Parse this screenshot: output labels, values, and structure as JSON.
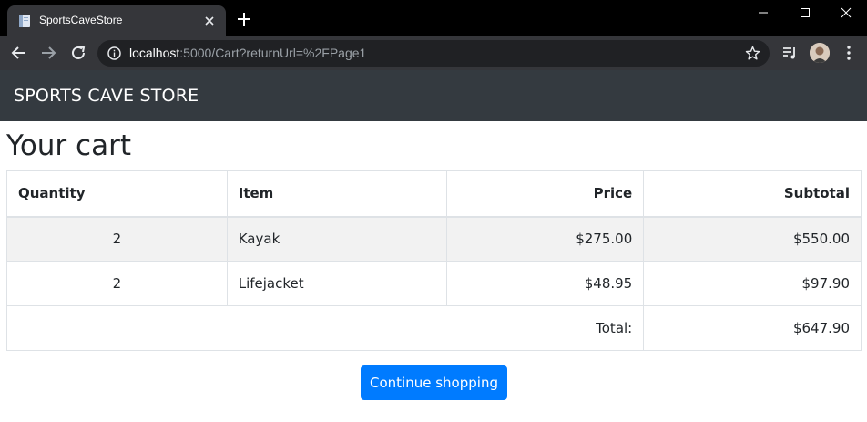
{
  "browser": {
    "tab_title": "SportsCaveStore",
    "url_host": "localhost",
    "url_rest": ":5000/Cart?returnUrl=%2FPage1"
  },
  "icons": {
    "favicon": "document-icon",
    "tab_close": "close-icon",
    "new_tab": "plus-icon",
    "back": "back-arrow-icon",
    "forward": "forward-arrow-icon",
    "reload": "reload-icon",
    "info": "info-icon",
    "bookmark": "star-icon",
    "media": "media-playlist-icon",
    "profile": "avatar",
    "menu": "kebab-menu-icon"
  },
  "navbar": {
    "brand": "SPORTS CAVE STORE"
  },
  "page": {
    "title": "Your cart"
  },
  "cart": {
    "headers": {
      "quantity": "Quantity",
      "item": "Item",
      "price": "Price",
      "subtotal": "Subtotal"
    },
    "rows": [
      {
        "quantity": "2",
        "item": "Kayak",
        "price": "$275.00",
        "subtotal": "$550.00"
      },
      {
        "quantity": "2",
        "item": "Lifejacket",
        "price": "$48.95",
        "subtotal": "$97.90"
      }
    ],
    "total_label": "Total:",
    "total_value": "$647.90"
  },
  "actions": {
    "continue_shopping": "Continue shopping"
  },
  "colors": {
    "navbar_bg": "#343a40",
    "primary": "#007bff",
    "stripe": "#f2f2f2",
    "border": "#dee2e6"
  }
}
